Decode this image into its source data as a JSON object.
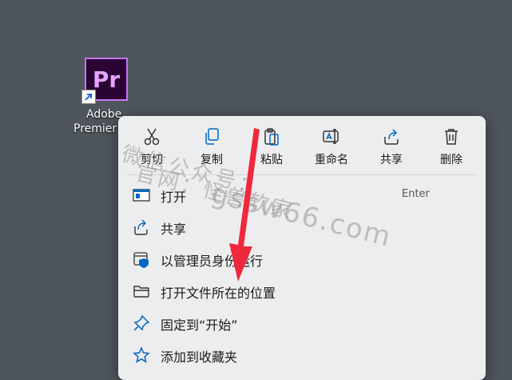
{
  "desktop_icon": {
    "tile_text": "Pr",
    "label_line1": "Adobe",
    "label_line2": "Premier"
  },
  "toolbar": [
    {
      "label": "剪切",
      "icon": "scissors-icon"
    },
    {
      "label": "复制",
      "icon": "copy-icon"
    },
    {
      "label": "粘贴",
      "icon": "paste-icon"
    },
    {
      "label": "重命名",
      "icon": "rename-icon"
    },
    {
      "label": "共享",
      "icon": "share-icon"
    },
    {
      "label": "删除",
      "icon": "trash-icon"
    }
  ],
  "items": [
    {
      "label": "打开",
      "shortcut": "Enter",
      "icon": "open-window-icon"
    },
    {
      "label": "共享",
      "icon": "share-icon"
    },
    {
      "label": "以管理员身份运行",
      "icon": "admin-shield-icon"
    },
    {
      "label": "打开文件所在的位置",
      "icon": "folder-icon"
    },
    {
      "label": "固定到“开始”",
      "icon": "pin-icon"
    },
    {
      "label": "添加到收藏夹",
      "icon": "star-icon"
    }
  ],
  "watermark": {
    "line1": "微信公众号：",
    "line2": "官网：怪兽软家",
    "line3": "gssw66.com"
  },
  "colors": {
    "desktop": "#4f555c",
    "menu_bg": "#ecedef",
    "accent": "#0067c0",
    "arrow": "#f0283c"
  }
}
